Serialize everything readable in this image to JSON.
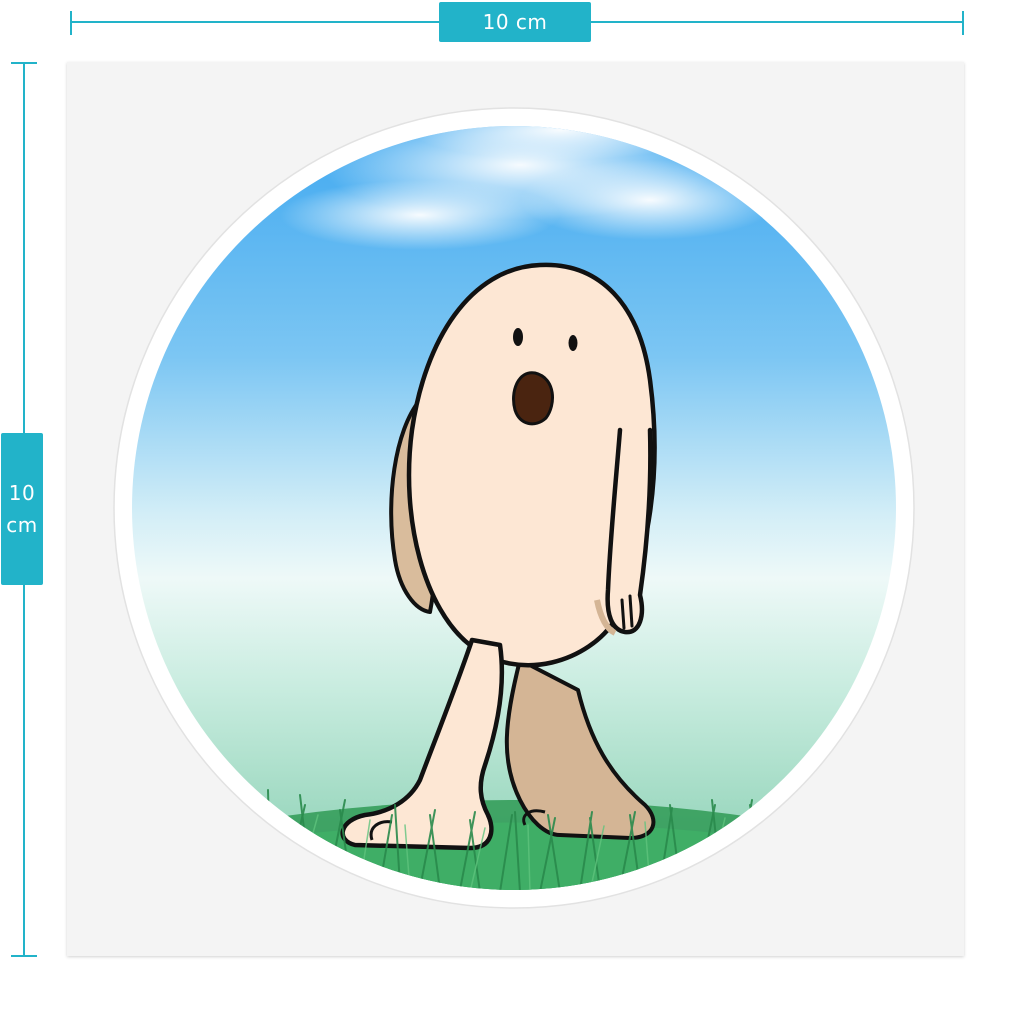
{
  "dimensions": {
    "width_label": "10 cm",
    "height_label_line1": "10",
    "height_label_line2": "cm"
  },
  "colors": {
    "dimension_accent": "#22b3c9",
    "sheet_background": "#f4f4f4",
    "sky_top": "#4fb2f2",
    "sky_mid": "#e8f6f8",
    "ground_mint": "#a9dfc9",
    "grass": "#2f9a55",
    "character_body": "#fde7d4",
    "character_shadow": "#d7b797"
  },
  "sticker": {
    "shape": "circle",
    "icon": "walking-egg-character-icon"
  }
}
